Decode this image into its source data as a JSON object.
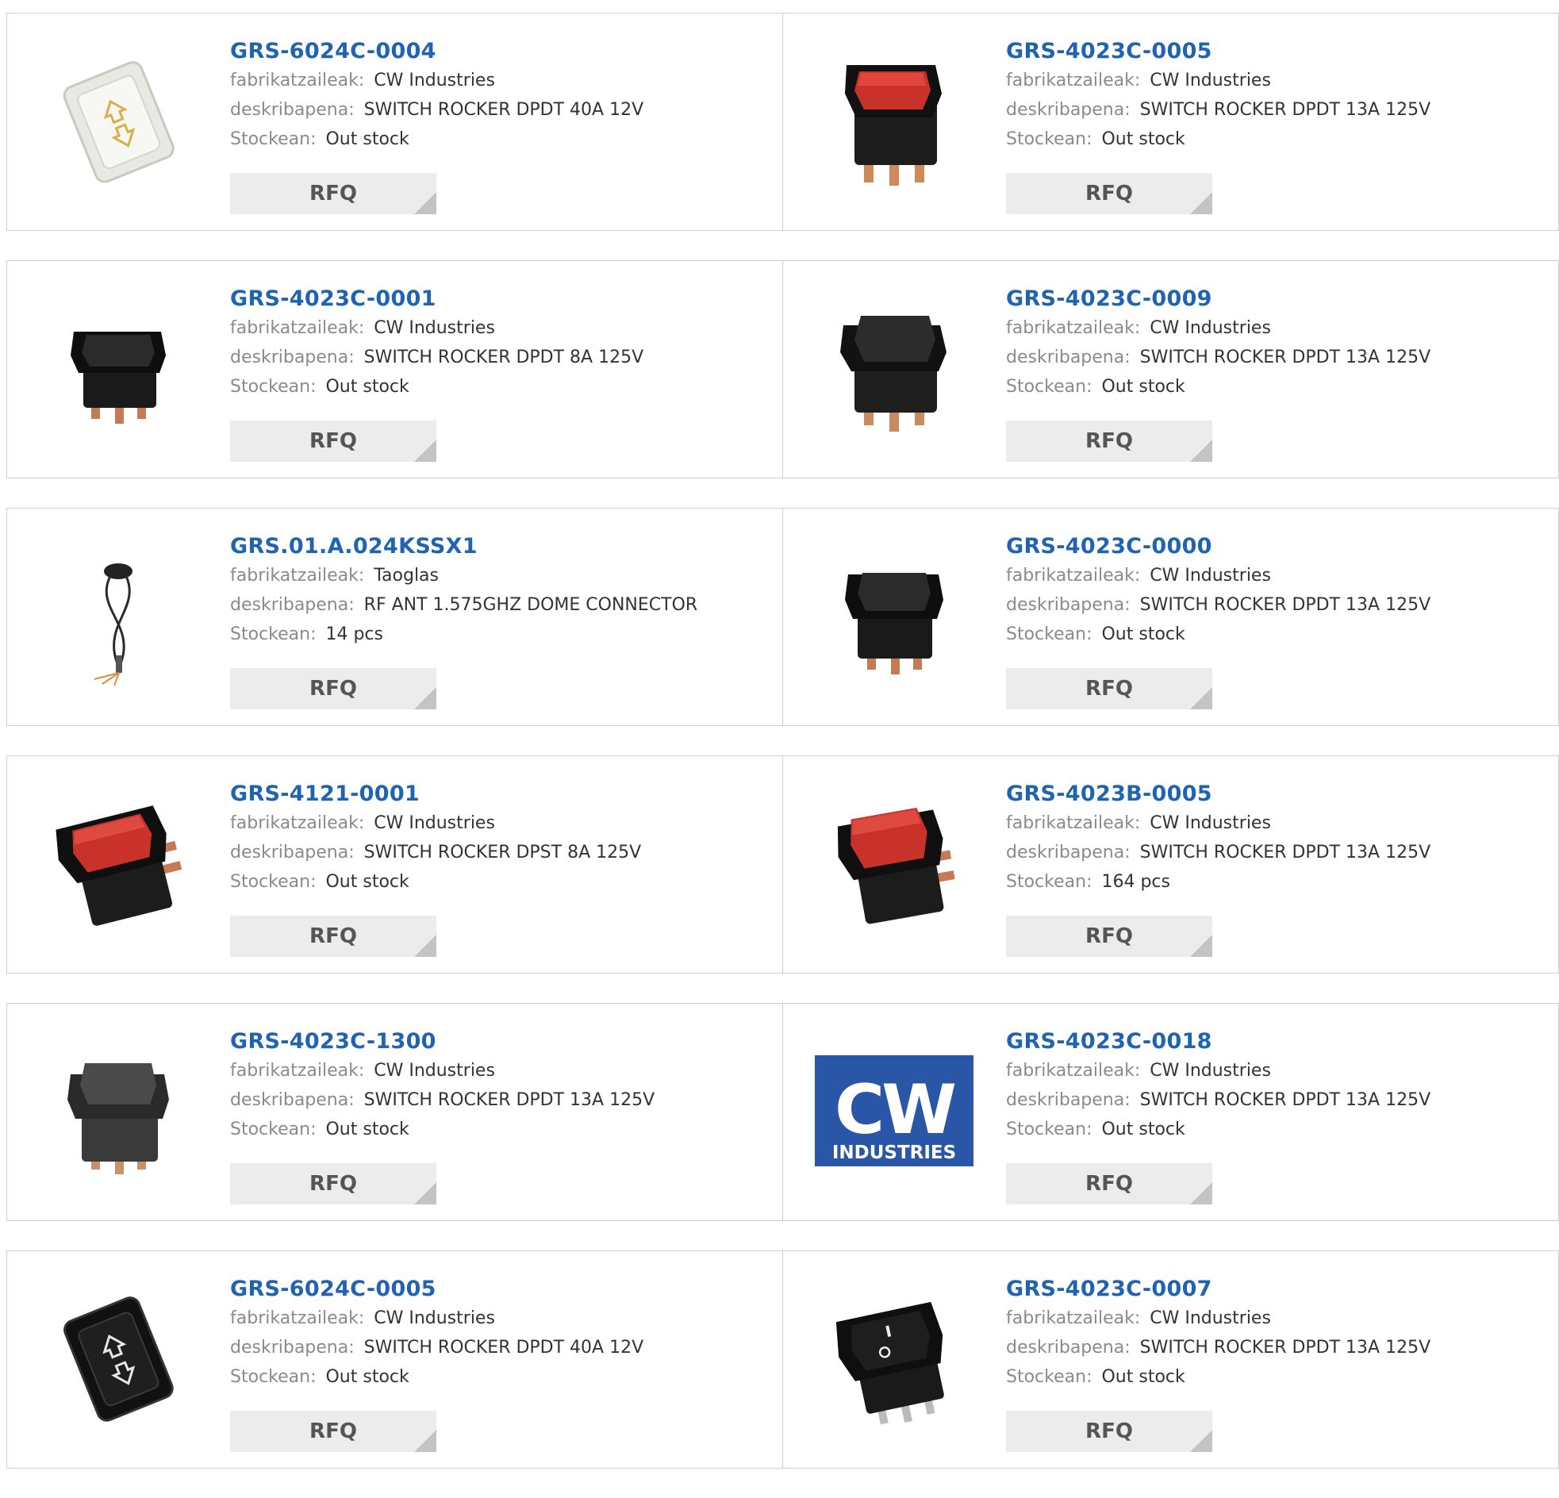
{
  "labels": {
    "manufacturer": "fabrikatzaileak:",
    "description": "deskribapena:",
    "stock": "Stockean:",
    "rfq": "RFQ"
  },
  "colors": {
    "link": "#1f63b1",
    "label": "#8a8a8a",
    "button_bg": "#ececec"
  },
  "products": [
    {
      "part": "GRS-6024C-0004",
      "manufacturer": "CW Industries",
      "description": "SWITCH ROCKER DPDT 40A 12V",
      "stock": "Out stock",
      "image": "white-window-switch-icon"
    },
    {
      "part": "GRS-4023C-0005",
      "manufacturer": "CW Industries",
      "description": "SWITCH ROCKER DPDT 13A 125V",
      "stock": "Out stock",
      "image": "red-rocker-switch-icon"
    },
    {
      "part": "GRS-4023C-0001",
      "manufacturer": "CW Industries",
      "description": "SWITCH ROCKER DPDT 8A 125V",
      "stock": "Out stock",
      "image": "black-rocker-switch-icon"
    },
    {
      "part": "GRS-4023C-0009",
      "manufacturer": "CW Industries",
      "description": "SWITCH ROCKER DPDT 13A 125V",
      "stock": "Out stock",
      "image": "black-rocker-switch-icon"
    },
    {
      "part": "GRS.01.A.024KSSX1",
      "manufacturer": "Taoglas",
      "description": "RF ANT 1.575GHZ DOME CONNECTOR",
      "stock": "14 pcs",
      "image": "dome-antenna-icon"
    },
    {
      "part": "GRS-4023C-0000",
      "manufacturer": "CW Industries",
      "description": "SWITCH ROCKER DPDT 13A 125V",
      "stock": "Out stock",
      "image": "black-rocker-switch-icon"
    },
    {
      "part": "GRS-4121-0001",
      "manufacturer": "CW Industries",
      "description": "SWITCH ROCKER DPST 8A 125V",
      "stock": "Out stock",
      "image": "red-rocker-switch-icon"
    },
    {
      "part": "GRS-4023B-0005",
      "manufacturer": "CW Industries",
      "description": "SWITCH ROCKER DPDT 13A 125V",
      "stock": "164 pcs",
      "image": "red-rocker-switch-icon"
    },
    {
      "part": "GRS-4023C-1300",
      "manufacturer": "CW Industries",
      "description": "SWITCH ROCKER DPDT 13A 125V",
      "stock": "Out stock",
      "image": "gray-rocker-switch-icon"
    },
    {
      "part": "GRS-4023C-0018",
      "manufacturer": "CW Industries",
      "description": "SWITCH ROCKER DPDT 13A 125V",
      "stock": "Out stock",
      "image": "cw-industries-logo",
      "logo_text": {
        "top": "CW",
        "bottom": "INDUSTRIES"
      }
    },
    {
      "part": "GRS-6024C-0005",
      "manufacturer": "CW Industries",
      "description": "SWITCH ROCKER DPDT 40A 12V",
      "stock": "Out stock",
      "image": "black-window-switch-icon"
    },
    {
      "part": "GRS-4023C-0007",
      "manufacturer": "CW Industries",
      "description": "SWITCH ROCKER DPDT 13A 125V",
      "stock": "Out stock",
      "image": "on-off-rocker-switch-icon"
    }
  ]
}
